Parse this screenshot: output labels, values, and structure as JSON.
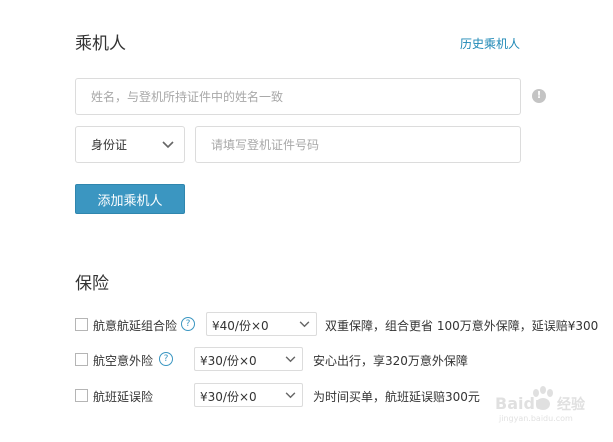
{
  "passenger": {
    "title": "乘机人",
    "history_link": "历史乘机人",
    "name_placeholder": "姓名，与登机所持证件中的姓名一致",
    "id_type": "身份证",
    "id_number_placeholder": "请填写登机证件号码",
    "add_button": "添加乘机人",
    "info_icon_glyph": "!"
  },
  "insurance": {
    "title": "保险",
    "items": [
      {
        "name": "航意航延组合险",
        "price": "¥40/份×0",
        "desc": "双重保障，组合更省   100万意外保障，延误赔¥300"
      },
      {
        "name": "航空意外险",
        "price": "¥30/份×0",
        "desc": "安心出行，享320万意外保障"
      },
      {
        "name": "航班延误险",
        "price": "¥30/份×0",
        "desc": "为时间买单，航班延误赔300元"
      }
    ],
    "help_glyph": "?"
  },
  "watermark": {
    "brand": "Baidu",
    "sub": "经验",
    "url": "jingyan.baidu.com"
  },
  "colors": {
    "accent": "#3b96c1",
    "link": "#1e88b6",
    "border": "#dcdcdc"
  }
}
